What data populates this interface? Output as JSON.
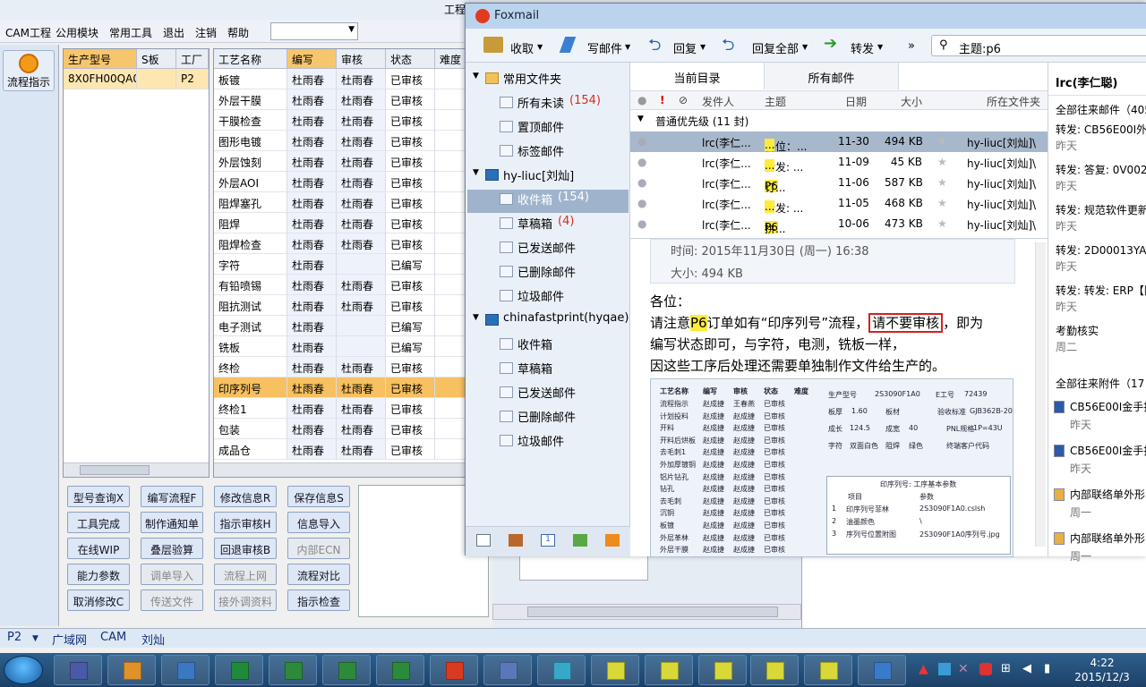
{
  "cam": {
    "title_fragment": "工程",
    "menu": [
      "CAM工程",
      "公用模块",
      "常用工具",
      "退出",
      "注销",
      "帮助"
    ],
    "flow_button": "流程指示",
    "panel1": {
      "headers": [
        "生产型号",
        "S板",
        "工厂"
      ],
      "row": [
        "8X0FH00QA0",
        "",
        "P2"
      ]
    },
    "panel2": {
      "headers": [
        "工艺名称",
        "编写",
        "审核",
        "状态",
        "难度"
      ],
      "rows": [
        [
          "板镀",
          "杜雨春",
          "杜雨春",
          "已审核"
        ],
        [
          "外层干膜",
          "杜雨春",
          "杜雨春",
          "已审核"
        ],
        [
          "干膜检查",
          "杜雨春",
          "杜雨春",
          "已审核"
        ],
        [
          "图形电镀",
          "杜雨春",
          "杜雨春",
          "已审核"
        ],
        [
          "外层蚀刻",
          "杜雨春",
          "杜雨春",
          "已审核"
        ],
        [
          "外层AOI",
          "杜雨春",
          "杜雨春",
          "已审核"
        ],
        [
          "阻焊塞孔",
          "杜雨春",
          "杜雨春",
          "已审核"
        ],
        [
          "阻焊",
          "杜雨春",
          "杜雨春",
          "已审核"
        ],
        [
          "阻焊检查",
          "杜雨春",
          "杜雨春",
          "已审核"
        ],
        [
          "字符",
          "杜雨春",
          "",
          "已编写"
        ],
        [
          "有铅喷锡",
          "杜雨春",
          "杜雨春",
          "已审核"
        ],
        [
          "阻抗测试",
          "杜雨春",
          "杜雨春",
          "已审核"
        ],
        [
          "电子测试",
          "杜雨春",
          "",
          "已编写"
        ],
        [
          "铣板",
          "杜雨春",
          "",
          "已编写"
        ],
        [
          "终检",
          "杜雨春",
          "杜雨春",
          "已审核"
        ],
        [
          "印序列号",
          "杜雨春",
          "杜雨春",
          "已审核"
        ],
        [
          "终检1",
          "杜雨春",
          "杜雨春",
          "已审核"
        ],
        [
          "包装",
          "杜雨春",
          "杜雨春",
          "已审核"
        ],
        [
          "成品仓",
          "杜雨春",
          "杜雨春",
          "已审核"
        ]
      ]
    },
    "buttons": [
      [
        "型号查询X",
        "编写流程F",
        "修改信息R",
        "保存信息S"
      ],
      [
        "工具完成",
        "制作通知单",
        "指示审核H",
        "信息导入"
      ],
      [
        "在线WIP",
        "叠层验算",
        "回退审核B",
        "内部ECN"
      ],
      [
        "能力参数",
        "调单导入",
        "流程上网",
        "流程对比"
      ],
      [
        "取消修改C",
        "传送文件",
        "接外调资料",
        "指示检查"
      ]
    ],
    "status": {
      "factory": "P2",
      "items": [
        "广域网",
        "CAM",
        "刘灿"
      ]
    }
  },
  "foxmail": {
    "title": "Foxmail",
    "toolbar": {
      "receive": "收取",
      "write": "写邮件",
      "reply": "回复",
      "reply_all": "回复全部",
      "forward": "转发",
      "more": "»",
      "search": "主题:p6"
    },
    "folders": [
      {
        "label": "常用文件夹",
        "type": "group"
      },
      {
        "label": "所有未读",
        "count": "(154)"
      },
      {
        "label": "置顶邮件"
      },
      {
        "label": "标签邮件"
      },
      {
        "label": "hy-liuc[刘灿]",
        "type": "account"
      },
      {
        "label": "收件箱",
        "count": "(154)"
      },
      {
        "label": "草稿箱",
        "count": "(4)"
      },
      {
        "label": "已发送邮件"
      },
      {
        "label": "已删除邮件"
      },
      {
        "label": "垃圾邮件"
      },
      {
        "label": "chinafastprint(hyqae)",
        "type": "account"
      },
      {
        "label": "收件箱"
      },
      {
        "label": "草稿箱"
      },
      {
        "label": "已发送邮件"
      },
      {
        "label": "已删除邮件"
      },
      {
        "label": "垃圾邮件"
      }
    ],
    "tabs": [
      "当前目录",
      "所有邮件"
    ],
    "columns": [
      "发件人",
      "主题",
      "日期",
      "大小",
      "所在文件夹"
    ],
    "group": "普通优先级 (11 封)",
    "messages": [
      {
        "from": "lrc(李仁...",
        "subject": "各位：...",
        "hl": "...",
        "date": "11-30",
        "size": "494 KB",
        "folder": "hy-liuc[刘灿]\\"
      },
      {
        "from": "lrc(李仁...",
        "subject": "转发: ...",
        "hl": "...",
        "date": "11-09",
        "size": "45 KB",
        "folder": "hy-liuc[刘灿]\\"
      },
      {
        "from": "lrc(李仁...",
        "subject": "订...",
        "hl": "P6",
        "date": "11-06",
        "size": "587 KB",
        "folder": "hy-liuc[刘灿]\\"
      },
      {
        "from": "lrc(李仁...",
        "subject": "转发: ...",
        "hl": "...",
        "date": "11-05",
        "size": "468 KB",
        "folder": "hy-liuc[刘灿]\\"
      },
      {
        "from": "lrc(李仁...",
        "subject": "拼...",
        "hl": "P6",
        "date": "10-06",
        "size": "473 KB",
        "folder": "hy-liuc[刘灿]\\"
      }
    ],
    "preview": {
      "time": "时间: 2015年11月30日 (周一) 16:38",
      "size": "大小: 494 KB",
      "greeting": "各位：",
      "line1a": "请注意",
      "line1hl": "P6",
      "line1b": "订单如有“印序列号”流程，",
      "line1box": "请不要审核",
      "line1c": "，即为",
      "line2": "编写状态即可，与字符，电测，铣板一样，",
      "line3": "因这些工序后处理还需要单独制作文件给生产的。"
    },
    "embedded": {
      "headers": [
        "工艺名称",
        "编写",
        "审核",
        "状态",
        "难度"
      ],
      "rows": [
        [
          "流程指示",
          "赵成捷",
          "王春燕",
          "已审核"
        ],
        [
          "计划投料",
          "赵成捷",
          "赵成捷",
          "已审核"
        ],
        [
          "开料",
          "赵成捷",
          "赵成捷",
          "已审核"
        ],
        [
          "开料后烘板",
          "赵成捷",
          "赵成捷",
          "已审核"
        ],
        [
          "去毛刺1",
          "赵成捷",
          "赵成捷",
          "已审核"
        ],
        [
          "外加厚镀铜",
          "赵成捷",
          "赵成捷",
          "已审核"
        ],
        [
          "铝片钻孔",
          "赵成捷",
          "赵成捷",
          "已审核"
        ],
        [
          "钻孔",
          "赵成捷",
          "赵成捷",
          "已审核"
        ],
        [
          "去毛刺",
          "赵成捷",
          "赵成捷",
          "已审核"
        ],
        [
          "沉铜",
          "赵成捷",
          "赵成捷",
          "已审核"
        ],
        [
          "板镀",
          "赵成捷",
          "赵成捷",
          "已审核"
        ],
        [
          "外层革林",
          "赵成捷",
          "赵成捷",
          "已审核"
        ],
        [
          "外层干膜",
          "赵成捷",
          "赵成捷",
          "已审核"
        ]
      ],
      "info": [
        [
          "生产型号",
          "2S3090F1A0",
          "E工号",
          "72439"
        ],
        [
          "板厚",
          "1.60",
          "板材",
          "验收标准",
          "GJB362B-20"
        ],
        [
          "成长",
          "124.5",
          "成宽",
          "40",
          "PNL规格",
          "1P=43U"
        ],
        [
          "字符",
          "双面白色",
          "阻焊",
          "绿色",
          "终端客户代码"
        ]
      ],
      "param_title": "印序列号: 工序基本参数",
      "param_headers": [
        "项目",
        "参数"
      ],
      "params": [
        [
          "1",
          "印序列号菲林",
          "2S3090F1A0.cslsh"
        ],
        [
          "2",
          "油墨颜色",
          "\\"
        ],
        [
          "3",
          "序列号位置附图",
          "2S3090F1A0序列号.jpg"
        ]
      ]
    },
    "right": {
      "name": "lrc(李仁聪)",
      "all_mail": "全部往来邮件（405",
      "items": [
        {
          "s": "转发: CB56E00I外环",
          "d": "昨天"
        },
        {
          "s": "转发: 答复: 0V002F",
          "d": "昨天"
        },
        {
          "s": "转发: 规范软件更新",
          "d": "昨天"
        },
        {
          "s": "转发: 2D00013YA0",
          "d": "昨天"
        },
        {
          "s": "转发: 转发: ERP【阻",
          "d": "昨天"
        },
        {
          "s": "考勤核实",
          "d": "周二"
        }
      ],
      "all_attach": "全部往来附件（17",
      "attach": [
        {
          "s": "CB56E00I金手指",
          "d": "昨天"
        },
        {
          "s": "CB56E00I金手指",
          "d": "昨天"
        },
        {
          "s": "内部联络单外形",
          "d": "周一"
        },
        {
          "s": "内部联络单外形",
          "d": "周一"
        }
      ]
    }
  },
  "taskbar": {
    "time": "4:22",
    "date": "2015/12/3"
  }
}
